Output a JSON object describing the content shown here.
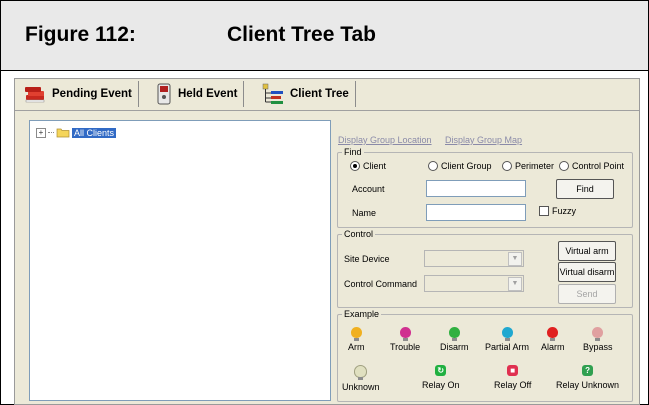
{
  "figure": {
    "label": "Figure 112:",
    "title": "Client Tree Tab"
  },
  "toolbar": {
    "pending": "Pending Event",
    "held": "Held Event",
    "client_tree": "Client Tree"
  },
  "tree": {
    "root": "All Clients",
    "expander": "+"
  },
  "links": {
    "location": "Display Group Location",
    "map": "Display Group Map"
  },
  "find": {
    "title": "Find",
    "radios": {
      "client": "Client",
      "client_group": "Client Group",
      "perimeter": "Perimeter",
      "control_point": "Control Point"
    },
    "account_label": "Account",
    "account_value": "",
    "name_label": "Name",
    "name_value": "",
    "find_button": "Find",
    "fuzzy_label": "Fuzzy"
  },
  "control": {
    "title": "Control",
    "site_device_label": "Site Device",
    "control_command_label": "Control Command",
    "virtual_arm": "Virtual arm",
    "virtual_disarm": "Virtual disarm",
    "send": "Send"
  },
  "example": {
    "title": "Example",
    "row1": {
      "arm": "Arm",
      "trouble": "Trouble",
      "disarm": "Disarm",
      "partial_arm": "Partial Arm",
      "alarm": "Alarm",
      "bypass": "Bypass"
    },
    "row2": {
      "unknown": "Unknown",
      "relay_on": "Relay On",
      "relay_off": "Relay Off",
      "relay_unknown": "Relay Unknown"
    }
  },
  "colors": {
    "arm": "#f0b020",
    "trouble": "#d03090",
    "disarm": "#30b040",
    "partial_arm": "#20a8d0",
    "alarm": "#e02020",
    "bypass": "#e0a0a0",
    "unknown": "#e0e0c0",
    "relay_on": "#20b040",
    "relay_off": "#e03050",
    "relay_unknown": "#30a050"
  }
}
